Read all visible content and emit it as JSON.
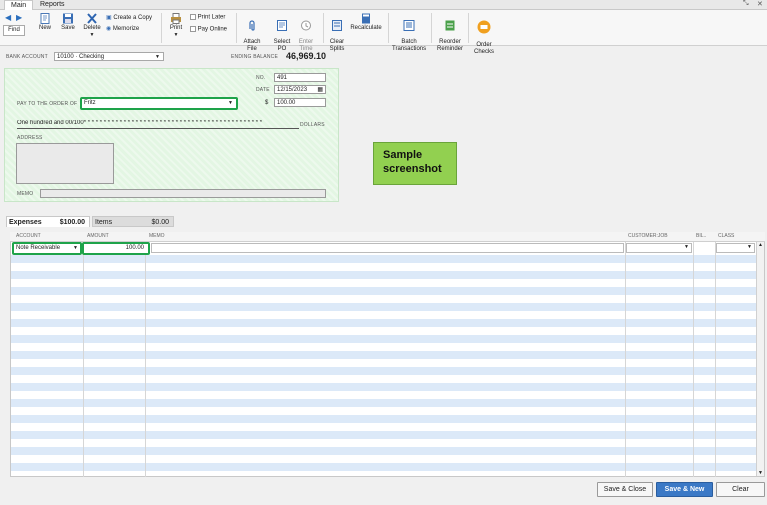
{
  "tabs": [
    {
      "label": "Main"
    },
    {
      "label": "Reports"
    }
  ],
  "toolbar": {
    "find": "Find",
    "new": "New",
    "save": "Save",
    "delete": "Delete",
    "create_copy": "Create a Copy",
    "memorize": "Memorize",
    "print": "Print",
    "print_later": "Print Later",
    "pay_online": "Pay Online",
    "attach_file": "Attach\nFile",
    "select_po": "Select\nPO",
    "enter_time": "Enter\nTime",
    "clear_splits": "Clear\nSplits",
    "recalculate": "Recalculate",
    "batch_transactions": "Batch\nTransactions",
    "reorder_reminder": "Reorder\nReminder",
    "order_checks": "Order\nChecks"
  },
  "bank": {
    "label": "BANK ACCOUNT",
    "account": "10100 · Checking",
    "ending_label": "ENDING BALANCE",
    "ending_value": "46,969.10"
  },
  "check": {
    "no_label": "NO.",
    "no": "491",
    "date_label": "DATE",
    "date": "12/15/2023",
    "payto_label": "PAY TO THE ORDER OF",
    "payee": "Fritz",
    "dollar_sign": "$",
    "amount": "100.00",
    "amount_words": "One hundred and 00/100* * * * * * * * * * * * * * * * * * * * * * * * * * * * * * * * * * * * * * * * * * * * *",
    "dollars_label": "DOLLARS",
    "address_label": "ADDRESS",
    "memo_label": "MEMO"
  },
  "sample_box": "Sample screenshot",
  "split_tabs": {
    "expenses": "Expenses",
    "expenses_amount": "$100.00",
    "items": "Items",
    "items_amount": "$0.00"
  },
  "grid": {
    "headers": [
      "ACCOUNT",
      "AMOUNT",
      "MEMO",
      "CUSTOMER:JOB",
      "BIL..",
      "CLASS"
    ],
    "row1": {
      "account": "Note Receivable",
      "amount": "100.00"
    }
  },
  "buttons": {
    "save_close": "Save & Close",
    "save_new": "Save & New",
    "clear": "Clear"
  }
}
